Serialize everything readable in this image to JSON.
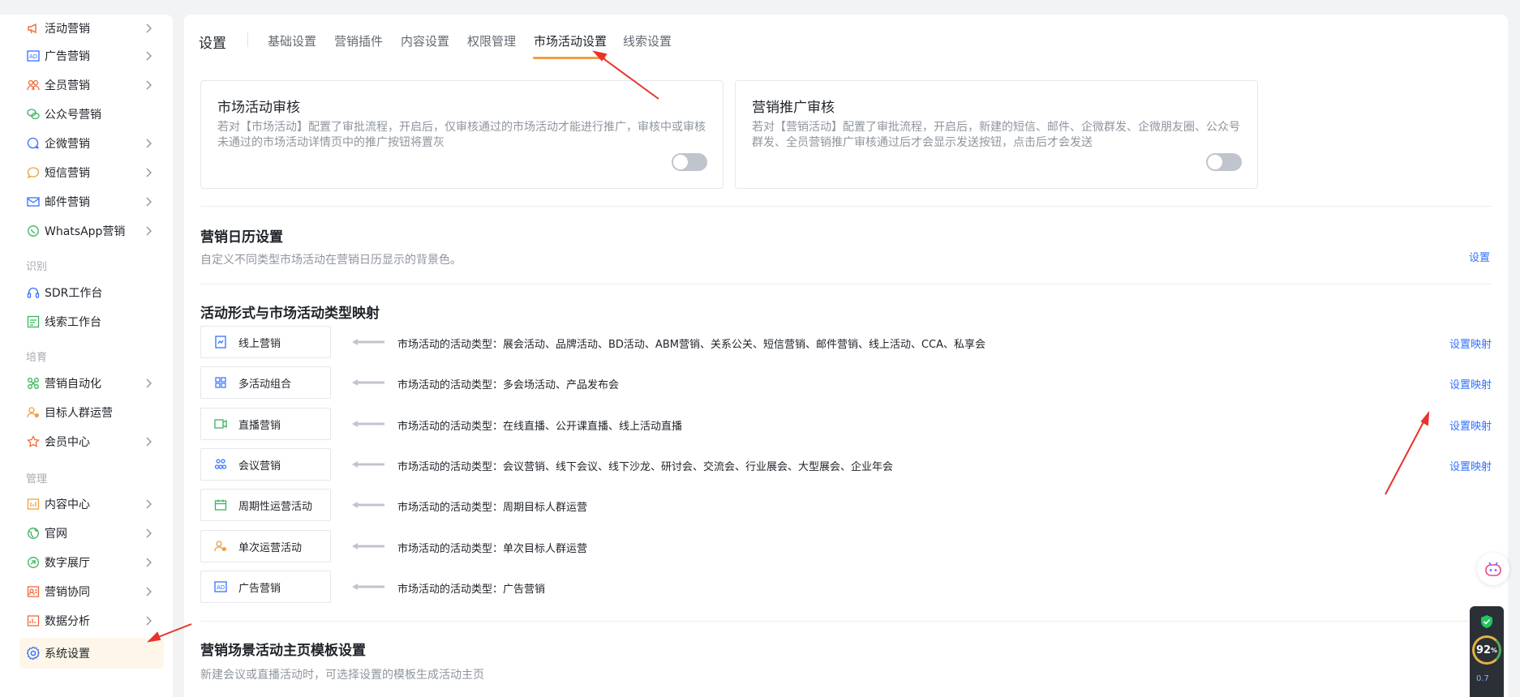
{
  "sidebar": {
    "items": [
      {
        "label": "活动营销",
        "icon": "megaphone-icon",
        "has_chevron": true
      },
      {
        "label": "广告营销",
        "icon": "ad-icon",
        "has_chevron": true
      },
      {
        "label": "全员营销",
        "icon": "team-icon",
        "has_chevron": true
      },
      {
        "label": "公众号营销",
        "icon": "wechat-icon",
        "has_chevron": false
      },
      {
        "label": "企微营销",
        "icon": "wecom-icon",
        "has_chevron": true
      },
      {
        "label": "短信营销",
        "icon": "sms-icon",
        "has_chevron": true
      },
      {
        "label": "邮件营销",
        "icon": "mail-icon",
        "has_chevron": true
      },
      {
        "label": "WhatsApp营销",
        "icon": "whatsapp-icon",
        "has_chevron": true
      }
    ],
    "group_identify": "识别",
    "identify_items": [
      {
        "label": "SDR工作台",
        "icon": "headset-icon"
      },
      {
        "label": "线索工作台",
        "icon": "lead-board-icon"
      }
    ],
    "group_nurture": "培育",
    "nurture_items": [
      {
        "label": "营销自动化",
        "icon": "automation-icon",
        "has_chevron": true
      },
      {
        "label": "目标人群运营",
        "icon": "target-audience-icon",
        "has_chevron": false
      },
      {
        "label": "会员中心",
        "icon": "member-icon",
        "has_chevron": true
      }
    ],
    "group_manage": "管理",
    "manage_items": [
      {
        "label": "内容中心",
        "icon": "content-icon",
        "has_chevron": true
      },
      {
        "label": "官网",
        "icon": "globe-icon",
        "has_chevron": true
      },
      {
        "label": "数字展厅",
        "icon": "showroom-icon",
        "has_chevron": true
      },
      {
        "label": "营销协同",
        "icon": "collab-icon",
        "has_chevron": true
      },
      {
        "label": "数据分析",
        "icon": "analytics-icon",
        "has_chevron": true
      },
      {
        "label": "系统设置",
        "icon": "gear-icon",
        "has_chevron": false,
        "active": true
      }
    ]
  },
  "tabs": {
    "title": "设置",
    "items": [
      "基础设置",
      "营销插件",
      "内容设置",
      "权限管理",
      "市场活动设置",
      "线索设置"
    ],
    "active_index": 4
  },
  "cards": [
    {
      "title": "市场活动审核",
      "desc": "若对【市场活动】配置了审批流程，开启后，仅审核通过的市场活动才能进行推广，审核中或审核未通过的市场活动详情页中的推广按钮将置灰",
      "enabled": false
    },
    {
      "title": "营销推广审核",
      "desc": "若对【营销活动】配置了审批流程，开启后，新建的短信、邮件、企微群发、企微朋友圈、公众号群发、全员营销推广审核通过后才会显示发送按钮，点击后才会发送",
      "enabled": false
    }
  ],
  "calendar": {
    "title": "营销日历设置",
    "desc": "自定义不同类型市场活动在营销日历显示的背景色。",
    "link": "设置"
  },
  "mapping": {
    "title": "活动形式与市场活动类型映射",
    "rows": [
      {
        "form": "线上营销",
        "icon": "online-doc-icon",
        "types": "市场活动的活动类型：展会活动、品牌活动、BD活动、ABM营销、关系公关、短信营销、邮件营销、线上活动、CCA、私享会",
        "link": "设置映射"
      },
      {
        "form": "多活动组合",
        "icon": "grid-icon",
        "types": "市场活动的活动类型：多会场活动、产品发布会",
        "link": "设置映射"
      },
      {
        "form": "直播营销",
        "icon": "video-icon",
        "types": "市场活动的活动类型：在线直播、公开课直播、线上活动直播",
        "link": "设置映射"
      },
      {
        "form": "会议营销",
        "icon": "meeting-icon",
        "types": "市场活动的活动类型：会议营销、线下会议、线下沙龙、研讨会、交流会、行业展会、大型展会、企业年会",
        "link": "设置映射"
      },
      {
        "form": "周期性运营活动",
        "icon": "calendar-icon",
        "types": "市场活动的活动类型：周期目标人群运营",
        "link": ""
      },
      {
        "form": "单次运营活动",
        "icon": "single-op-icon",
        "types": "市场活动的活动类型：单次目标人群运营",
        "link": ""
      },
      {
        "form": "广告营销",
        "icon": "ad-icon",
        "types": "市场活动的活动类型：广告营销",
        "link": ""
      }
    ]
  },
  "template": {
    "title": "营销场景活动主页模板设置",
    "desc": "新建会议或直播活动时，可选择设置的模板生成活动主页"
  },
  "perf": {
    "score": "92",
    "score_unit": "%",
    "sub": "0.7"
  },
  "colors": {
    "accent": "#3370ff",
    "active_tab_underline": "#f0a044",
    "active_side_bg": "#fdf6e9",
    "annotation_arrow": "#e8332a"
  }
}
